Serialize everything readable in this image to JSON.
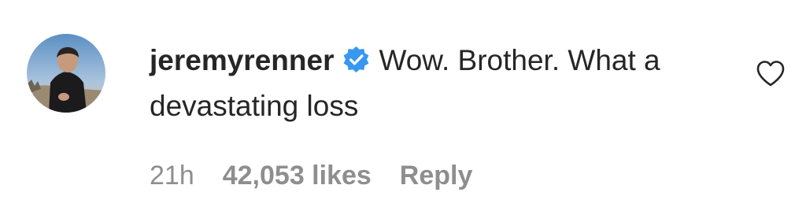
{
  "comment": {
    "username": "jeremyrenner",
    "verified_icon": "verified-badge-icon",
    "text": "Wow. Brother. What a devastating loss",
    "time": "21h",
    "likes": "42,053 likes",
    "reply_label": "Reply",
    "like_icon": "heart-icon"
  },
  "colors": {
    "text": "#262626",
    "meta": "#8e8e8e",
    "verified": "#3897f0"
  }
}
